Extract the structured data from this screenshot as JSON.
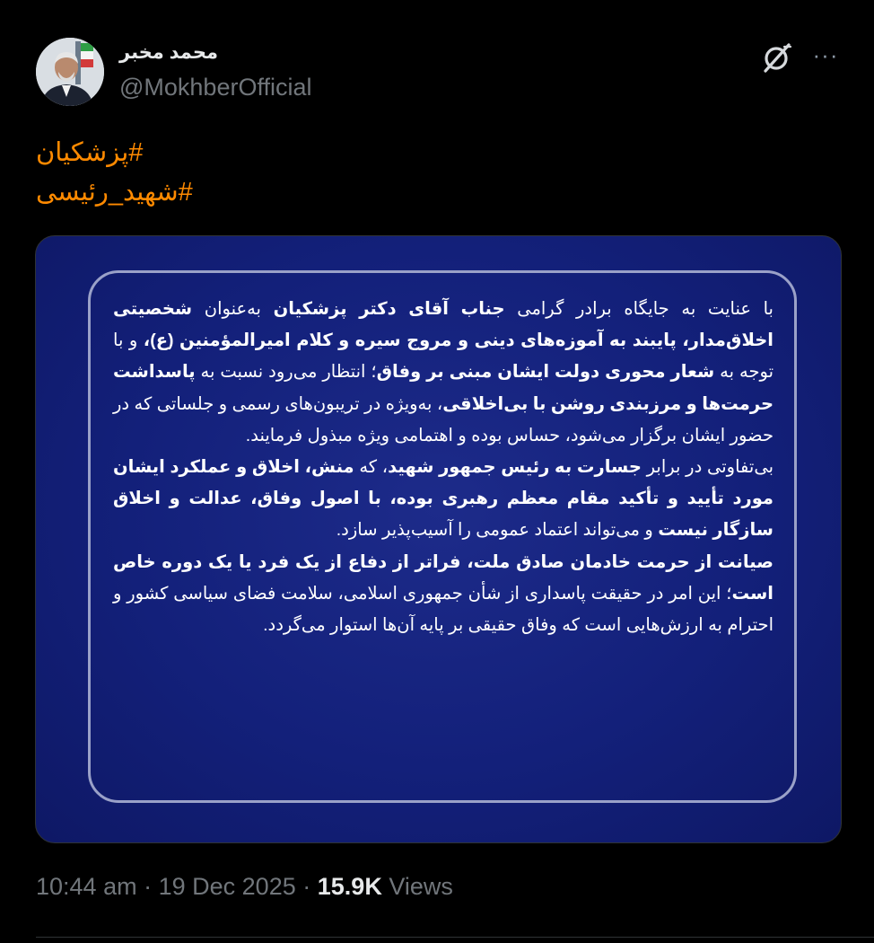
{
  "author": {
    "display_name": "محمد مخبر",
    "handle": "@MokhberOfficial",
    "avatar_icon": "profile-photo"
  },
  "header_icons": {
    "grok": "grok-icon",
    "more": "more-options-icon",
    "more_glyph": "···"
  },
  "hashtags": [
    "#پزشکیان",
    "#شهید_رئیسی"
  ],
  "hashtag_color": "#ff8a00",
  "image": {
    "background_color": "#13207a",
    "paragraphs": [
      [
        {
          "t": "با عنایت به جایگاه برادر گرامی ",
          "b": false
        },
        {
          "t": "جناب آقای دکتر پزشکیان",
          "b": true
        },
        {
          "t": " به‌عنوان ",
          "b": false
        },
        {
          "t": "شخصیتی اخلاق‌مدار، پایبند به آموزه‌های دینی و مروج سیره و کلام امیرالمؤمنین (ع)،",
          "b": true
        },
        {
          "t": " و با توجه به ",
          "b": false
        },
        {
          "t": "شعار محوری دولت ایشان مبنی بر وفاق",
          "b": true
        },
        {
          "t": "؛ انتظار می‌رود نسبت به ",
          "b": false
        },
        {
          "t": "پاسداشت حرمت‌ها و مرزبندی روشن با بی‌اخلاقی",
          "b": true
        },
        {
          "t": "، به‌ویژه در تریبون‌های رسمی و جلساتی که در حضور ایشان برگزار می‌شود، حساس بوده و اهتمامی ویژه مبذول فرمایند.",
          "b": false
        }
      ],
      [
        {
          "t": "بی‌تفاوتی در برابر ",
          "b": false
        },
        {
          "t": "جسارت به رئیس جمهور شهید",
          "b": true
        },
        {
          "t": "، که ",
          "b": false
        },
        {
          "t": "منش، اخلاق و عملکرد ایشان مورد تأیید و تأکید مقام معظم رهبری بوده، با اصول وفاق، عدالت و اخلاق سازگار نیست",
          "b": true
        },
        {
          "t": " و می‌تواند اعتماد عمومی را آسیب‌پذیر سازد.",
          "b": false
        }
      ],
      [
        {
          "t": "صیانت از حرمت خادمان صادق ملت، فراتر از دفاع از یک فرد یا یک دوره خاص است",
          "b": true
        },
        {
          "t": "؛ این امر در حقیقت پاسداری از شأن جمهوری اسلامی، سلامت فضای سیاسی کشور و احترام به ارزش‌هایی است که وفاق حقیقی بر پایه آن‌ها استوار می‌گردد.",
          "b": false
        }
      ]
    ]
  },
  "meta": {
    "time": "10:44 am",
    "separator": "·",
    "date": "19 Dec 2025",
    "views_count": "15.9K",
    "views_label": "Views"
  }
}
